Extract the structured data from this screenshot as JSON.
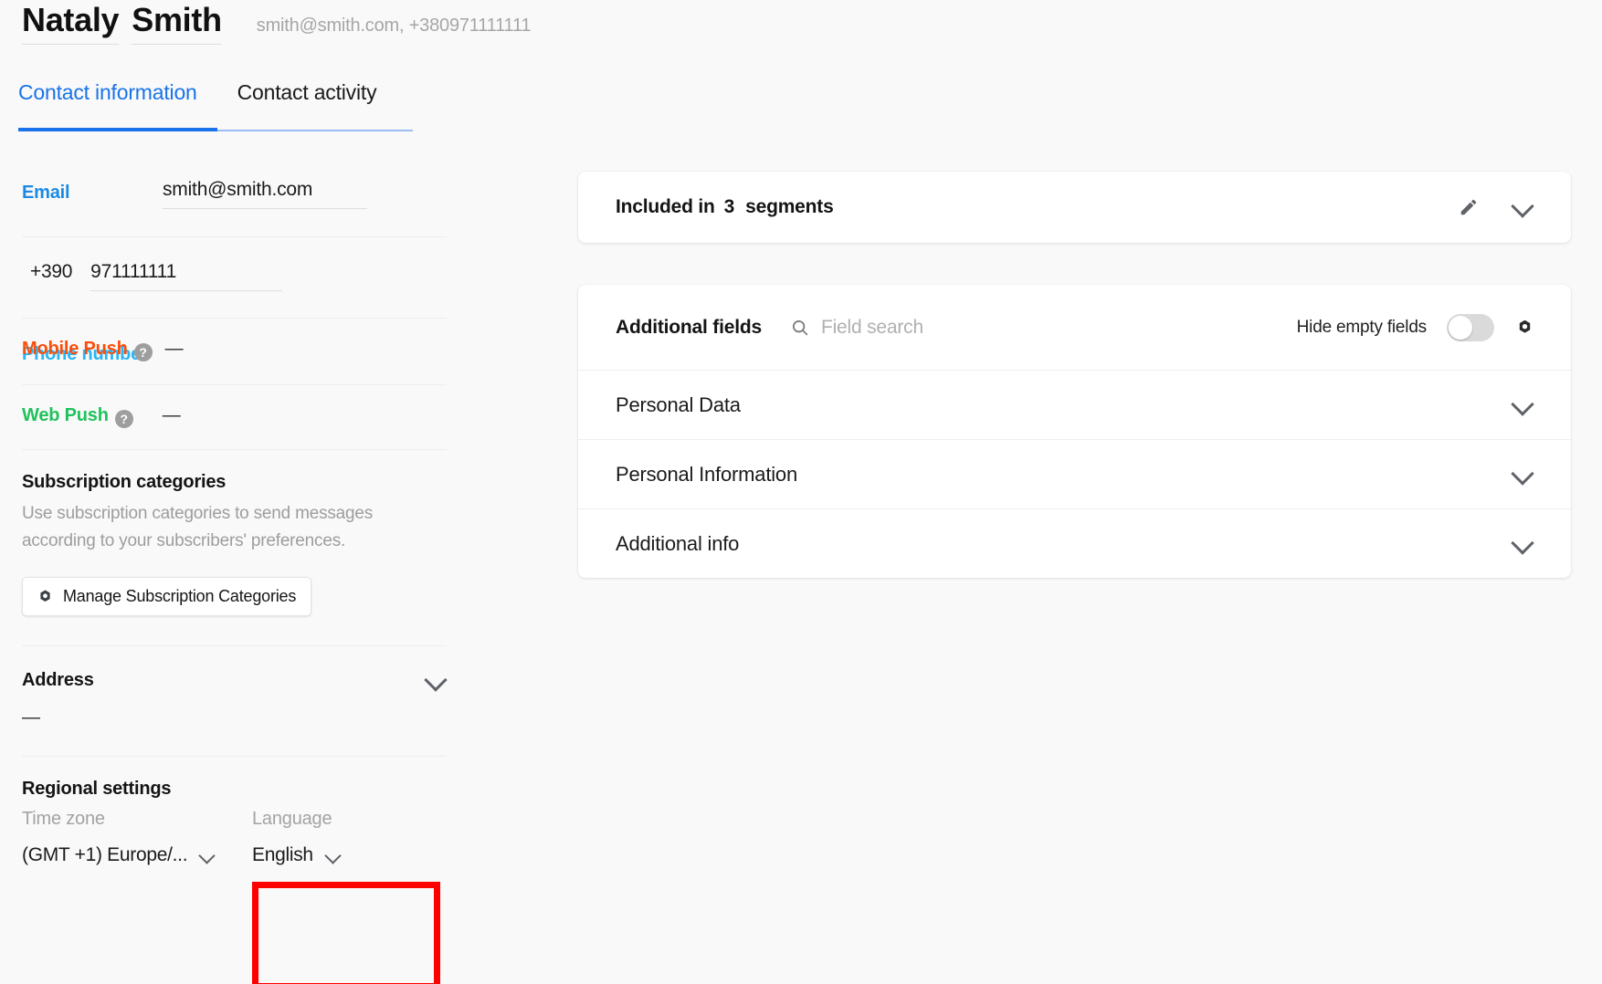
{
  "header": {
    "first_name": "Nataly",
    "last_name": "Smith",
    "subtitle": "smith@smith.com, +380971111111"
  },
  "tabs": [
    {
      "label": "Contact information",
      "active": true
    },
    {
      "label": "Contact activity",
      "active": false
    }
  ],
  "contact_fields": {
    "email": {
      "label": "Email",
      "value": "smith@smith.com"
    },
    "phone": {
      "label": "Phone number",
      "country_code": "+390",
      "value": "971111111"
    },
    "mobile_push": {
      "label": "Mobile Push",
      "help": "?",
      "value": "—"
    },
    "web_push": {
      "label": "Web Push",
      "help": "?",
      "value": "—"
    }
  },
  "subscription": {
    "title": "Subscription categories",
    "description": "Use subscription categories to send messages according to your subscribers' preferences.",
    "manage_button": "Manage Subscription Categories"
  },
  "address": {
    "title": "Address",
    "value": "—"
  },
  "regional": {
    "title": "Regional settings",
    "timezone_label": "Time zone",
    "timezone_value": "(GMT +1) Europe/...",
    "language_label": "Language",
    "language_value": "English"
  },
  "segments_card": {
    "prefix": "Included in",
    "count": "3",
    "suffix": "segments"
  },
  "additional_fields": {
    "title": "Additional fields",
    "search_placeholder": "Field search",
    "hide_empty_label": "Hide empty fields",
    "toggle_state": "off",
    "rows": [
      {
        "label": "Personal Data"
      },
      {
        "label": "Personal Information"
      },
      {
        "label": "Additional info"
      }
    ]
  },
  "colors": {
    "accent_blue": "#1a73e8",
    "email_blue": "#1a8ae5",
    "phone_cyan": "#29b6f6",
    "mobile_push_orange": "#fb4e0b",
    "web_push_green": "#1fc25c",
    "highlight_red": "#ff0000",
    "page_bg": "#f9f9f9"
  }
}
